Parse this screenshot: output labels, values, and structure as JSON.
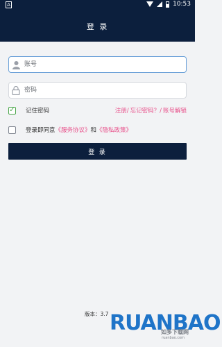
{
  "status_bar": {
    "time": "10:53",
    "left_icon": "A"
  },
  "app_bar": {
    "title": "登 录"
  },
  "form": {
    "account_placeholder": "账号",
    "password_placeholder": "密码",
    "remember_label": "记住密码",
    "remember_checked": true,
    "links": {
      "register": "注册/",
      "forgot": "忘记密码？/",
      "unlock": "账号解锁"
    },
    "agreement": {
      "prefix": "登录即同意",
      "service": "《服务协议》",
      "and": "和",
      "privacy": "《隐私政策》",
      "checked": false
    },
    "login_button": "登 录"
  },
  "footer": {
    "version": "版本：3.7"
  },
  "watermark": {
    "main": "RUANBAO",
    "sub": "如多下载网",
    "url": "ruanbao.com"
  },
  "colors": {
    "header": "#0c1f3d",
    "accent_link": "#e8508a",
    "check": "#4aa64a"
  }
}
